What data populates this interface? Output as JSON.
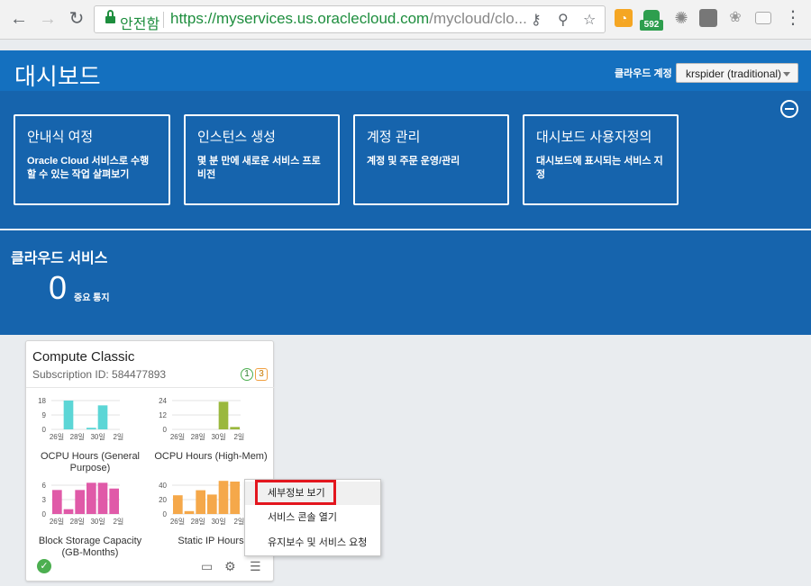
{
  "browser": {
    "secure_label": "안전함",
    "url_host": "https://myservices.us.oraclecloud.com",
    "url_rest": "/mycloud/clo...",
    "badge_count": "592"
  },
  "header": {
    "title": "대시보드",
    "account_label": "클라우드 계정",
    "account_value": "krspider (traditional)"
  },
  "cards": [
    {
      "title": "안내식 여정",
      "desc": "Oracle Cloud 서비스로 수행할 수 있는 작업 살펴보기"
    },
    {
      "title": "인스턴스 생성",
      "desc": "몇 분 만에 새로운 서비스 프로비전"
    },
    {
      "title": "계정 관리",
      "desc": "계정 및 주문 운영/관리"
    },
    {
      "title": "대시보드 사용자정의",
      "desc": "대시보드에 표시되는 서비스 지정"
    }
  ],
  "cloud_services": {
    "title": "클라우드 서비스",
    "notification_count": "0",
    "notification_label": "중요 통지"
  },
  "tile": {
    "title": "Compute Classic",
    "subscription": "Subscription ID: 584477893",
    "badge_ok": "1",
    "badge_warn": "3"
  },
  "chart_data": [
    {
      "type": "bar",
      "title": "OCPU Hours (General Purpose)",
      "ylim": [
        0,
        18
      ],
      "yticks": [
        "18",
        "9",
        "0"
      ],
      "categories": [
        "26일",
        "28일",
        "30일",
        "2일"
      ],
      "values": [
        0,
        18,
        0,
        1,
        15,
        0
      ],
      "color": "#5cd6d6"
    },
    {
      "type": "bar",
      "title": "OCPU Hours (High-Mem)",
      "ylim": [
        0,
        24
      ],
      "yticks": [
        "24",
        "12",
        "0"
      ],
      "categories": [
        "26일",
        "28일",
        "30일",
        "2일"
      ],
      "values": [
        0,
        0,
        0,
        0,
        23,
        2
      ],
      "color": "#9ab83e"
    },
    {
      "type": "bar",
      "title": "Block Storage Capacity (GB-Months)",
      "ylim": [
        0,
        6
      ],
      "yticks": [
        "6",
        "3",
        "0"
      ],
      "categories": [
        "26일",
        "28일",
        "30일",
        "2일"
      ],
      "values": [
        5,
        1,
        5,
        6.5,
        6.5,
        5.3
      ],
      "color": "#e05aa8"
    },
    {
      "type": "bar",
      "title": "Static IP Hours",
      "ylim": [
        0,
        40
      ],
      "yticks": [
        "40",
        "20",
        "0"
      ],
      "categories": [
        "26일",
        "28일",
        "30일",
        "2일"
      ],
      "values": [
        26,
        4,
        33,
        27,
        46,
        45
      ],
      "color": "#f5a84a"
    }
  ],
  "context_menu": {
    "items": [
      "세부정보 보기",
      "서비스 콘솔 열기",
      "유지보수 및 서비스 요청"
    ]
  }
}
